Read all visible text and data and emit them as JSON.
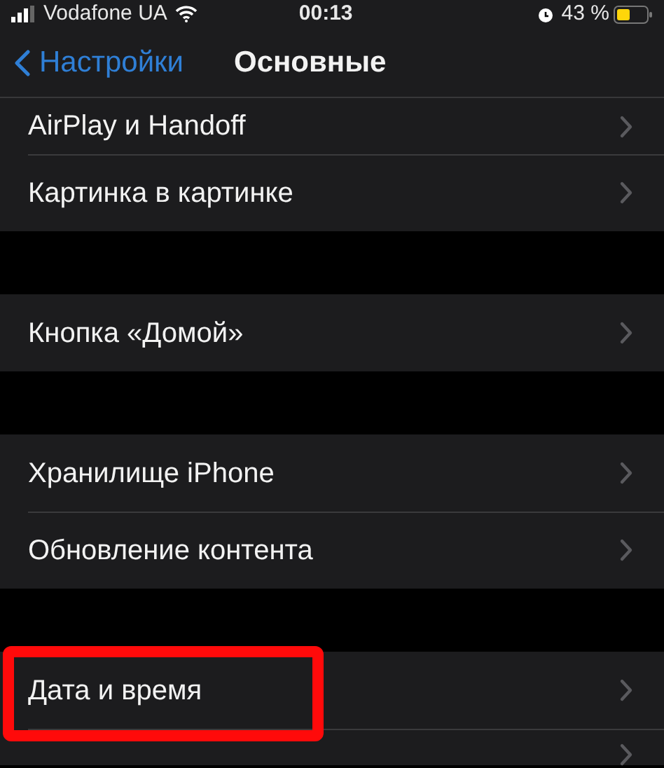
{
  "status_bar": {
    "carrier": "Vodafone UA",
    "time": "00:13",
    "battery": "43 %"
  },
  "nav_bar": {
    "back": "Настройки",
    "title": "Основные"
  },
  "groups": [
    {
      "items": [
        {
          "label": "AirPlay и Handoff",
          "highlighted": false
        },
        {
          "label": "Картинка в картинке",
          "highlighted": false
        }
      ]
    },
    {
      "items": [
        {
          "label": "Кнопка «Домой»",
          "highlighted": false
        }
      ]
    },
    {
      "items": [
        {
          "label": "Хранилище iPhone",
          "highlighted": false
        },
        {
          "label": "Обновление контента",
          "highlighted": false
        }
      ]
    },
    {
      "items": [
        {
          "label": "Дата и время",
          "highlighted": true
        },
        {
          "highlighted": false
        }
      ]
    }
  ]
}
